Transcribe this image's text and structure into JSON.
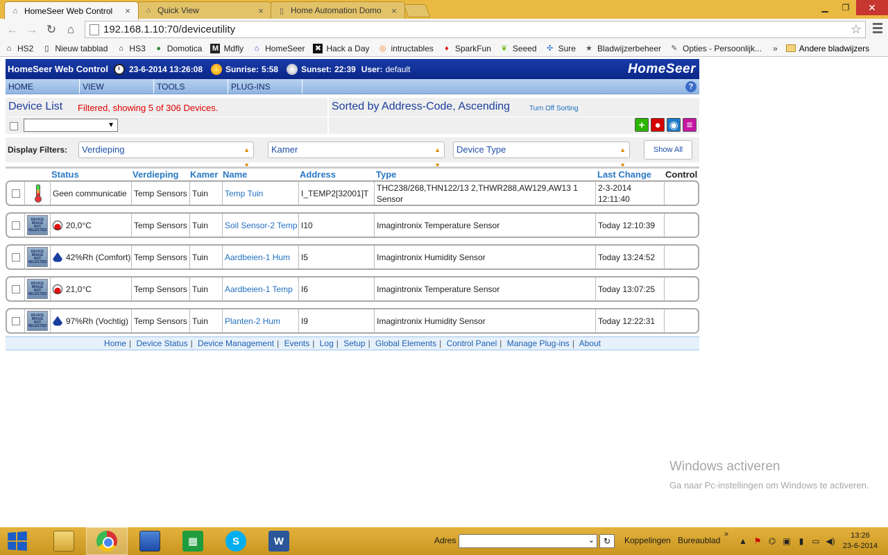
{
  "browser": {
    "tabs": [
      {
        "title": "HomeSeer Web Control",
        "active": true
      },
      {
        "title": "Quick View",
        "active": false
      },
      {
        "title": "Home Automation Domo",
        "active": false
      }
    ],
    "url": "192.168.1.10:70/deviceutility",
    "bookmarks": [
      "HS2",
      "Nieuw tabblad",
      "HS3",
      "Domotica",
      "Mdfly",
      "HomeSeer",
      "Hack a Day",
      "intructables",
      "SparkFun",
      "Seeed",
      "Sure",
      "Bladwijzerbeheer",
      "Opties - Persoonlijk..."
    ],
    "bookmarks_more": "»",
    "other_bookmarks": "Andere bladwijzers"
  },
  "header": {
    "title": "HomeSeer Web Control",
    "datetime": "23-6-2014 13:26:08",
    "sunrise_label": "Sunrise:",
    "sunrise": "5:58",
    "sunset_label": "Sunset:",
    "sunset": "22:39",
    "user_label": "User:",
    "user": "default",
    "logo": "HomeSeer"
  },
  "menu": [
    "HOME",
    "VIEW",
    "TOOLS",
    "PLUG-INS"
  ],
  "device_list": {
    "title": "Device List",
    "filtered": "Filtered, showing 5 of 306 Devices.",
    "sorted": "Sorted by Address-Code, Ascending",
    "turn_off_sorting": "Turn Off Sorting",
    "select_arrow": "▼"
  },
  "filters": {
    "label": "Display Filters:",
    "verdieping": "Verdieping",
    "kamer": "Kamer",
    "device_type": "Device Type",
    "show_all": "Show All"
  },
  "columns": {
    "status": "Status",
    "verdieping": "Verdieping",
    "kamer": "Kamer",
    "name": "Name",
    "address": "Address",
    "type": "Type",
    "last_change": "Last Change",
    "control": "Control"
  },
  "devices": [
    {
      "status": "Geen communicatie",
      "status_icon": "thermometer-icon",
      "verdieping": "Temp Sensors",
      "kamer": "Tuin",
      "name": "Temp Tuin",
      "address": "I_TEMP2[32001]T",
      "type": "THC238/268,THN122/13 2,THWR288,AW129,AW13 1 Sensor",
      "last_change": "2-3-2014 12:11:40"
    },
    {
      "status": "20,0°C",
      "status_icon": "temperature-icon",
      "verdieping": "Temp Sensors",
      "kamer": "Tuin",
      "name": "Soil Sensor-2 Temp",
      "address": "I10",
      "type": "Imagintronix Temperature Sensor",
      "last_change": "Today 12:10:39"
    },
    {
      "status": "42%Rh (Comfort)",
      "status_icon": "humidity-icon",
      "verdieping": "Temp Sensors",
      "kamer": "Tuin",
      "name": "Aardbeien-1 Hum",
      "address": "I5",
      "type": "Imagintronix Humidity Sensor",
      "last_change": "Today 13:24:52"
    },
    {
      "status": "21,0°C",
      "status_icon": "temperature-icon",
      "verdieping": "Temp Sensors",
      "kamer": "Tuin",
      "name": "Aardbeien-1 Temp",
      "address": "I6",
      "type": "Imagintronix Temperature Sensor",
      "last_change": "Today 13:07:25"
    },
    {
      "status": "97%Rh (Vochtig)",
      "status_icon": "humidity-icon",
      "verdieping": "Temp Sensors",
      "kamer": "Tuin",
      "name": "Planten-2 Hum",
      "address": "I9",
      "type": "Imagintronix Humidity Sensor",
      "last_change": "Today 12:22:31"
    }
  ],
  "footer_links": [
    "Home",
    "Device Status",
    "Device Management",
    "Events",
    "Log",
    "Setup",
    "Global Elements",
    "Control Panel",
    "Manage Plug-ins",
    "About"
  ],
  "watermark": {
    "title": "Windows activeren",
    "subtitle": "Ga naar Pc-instellingen om Windows te activeren."
  },
  "taskbar": {
    "address_label": "Adres",
    "links_label": "Koppelingen",
    "desktop_label": "Bureaublad",
    "chevron": "»",
    "time": "13:26",
    "date": "23-6-2014"
  }
}
